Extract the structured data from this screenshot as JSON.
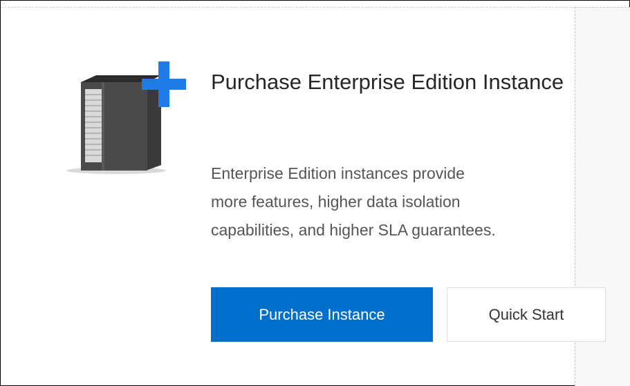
{
  "card": {
    "title": "Purchase Enterprise Edition Instance",
    "description": "Enterprise Edition instances provide\nmore features, higher data isolation\ncapabilities, and higher SLA guarantees.",
    "illustration_icon": "server-add-icon",
    "primary_button_label": "Purchase Instance",
    "secondary_button_label": "Quick Start"
  },
  "colors": {
    "primary": "#0070cc",
    "plus_accent": "#1f7be8",
    "title_text": "#262626",
    "description_text": "#555555"
  }
}
